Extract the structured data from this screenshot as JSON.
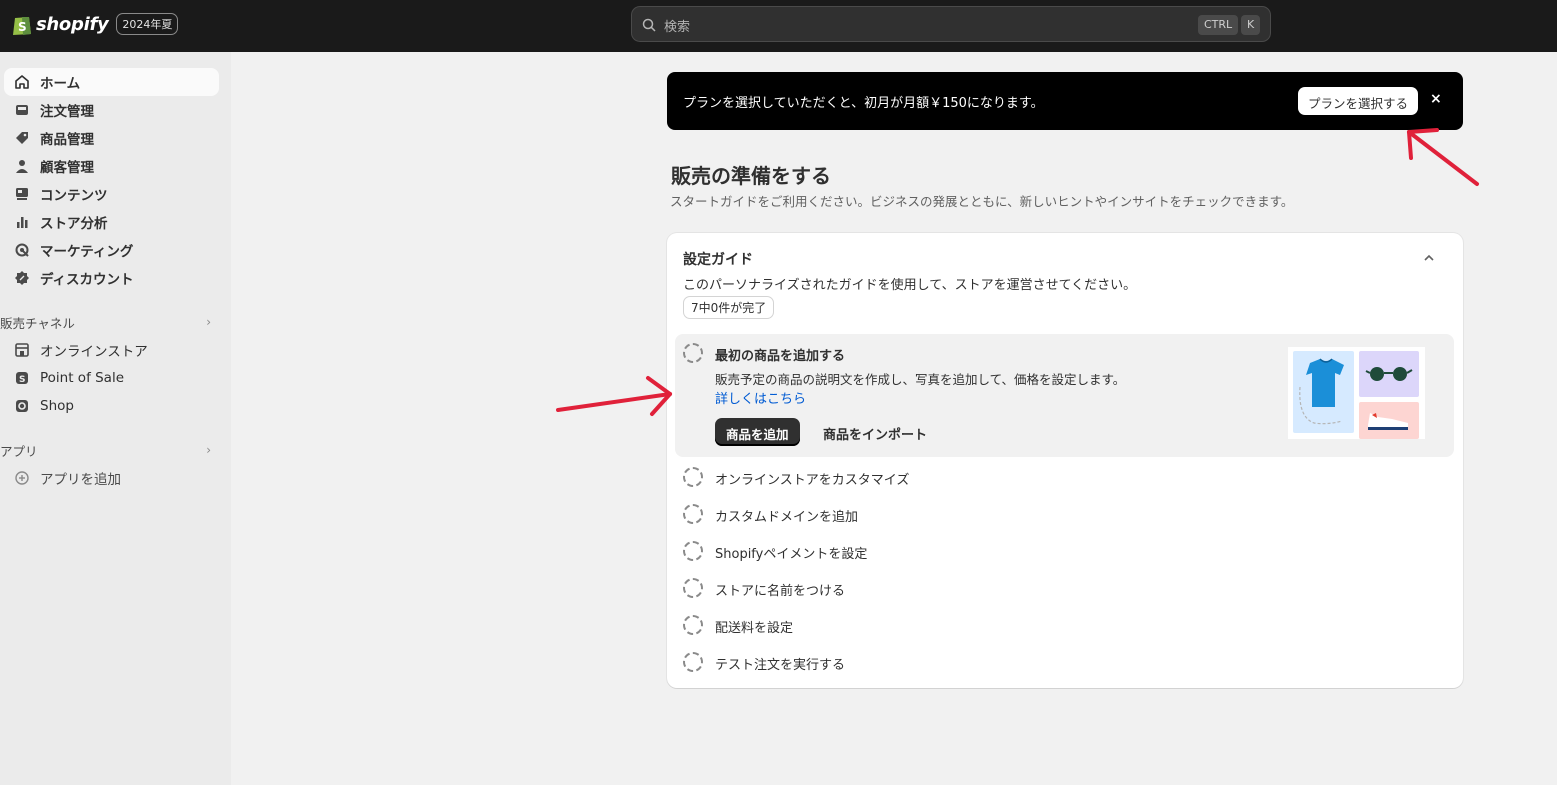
{
  "topbar": {
    "brand": "shopify",
    "edition": "2024年夏",
    "search_placeholder": "検索",
    "shortcut_ctrl": "CTRL",
    "shortcut_k": "K"
  },
  "sidebar": {
    "items": [
      {
        "label": "ホーム",
        "icon": "home-icon",
        "active": true
      },
      {
        "label": "注文管理",
        "icon": "inbox-icon"
      },
      {
        "label": "商品管理",
        "icon": "tag-icon"
      },
      {
        "label": "顧客管理",
        "icon": "person-icon"
      },
      {
        "label": "コンテンツ",
        "icon": "content-icon"
      },
      {
        "label": "ストア分析",
        "icon": "chart-icon"
      },
      {
        "label": "マーケティング",
        "icon": "target-icon"
      },
      {
        "label": "ディスカウント",
        "icon": "discount-icon"
      }
    ],
    "sales_channels_heading": "販売チャネル",
    "channels": [
      {
        "label": "オンラインストア",
        "icon": "store-icon"
      },
      {
        "label": "Point of Sale",
        "icon": "pos-icon"
      },
      {
        "label": "Shop",
        "icon": "shop-icon"
      }
    ],
    "apps_heading": "アプリ",
    "add_app": "アプリを追加"
  },
  "banner": {
    "text": "プランを選択していただくと、初月が月額￥150になります。",
    "button": "プランを選択する",
    "close": "×"
  },
  "main": {
    "title": "販売の準備をする",
    "subtitle": "スタートガイドをご利用ください。ビジネスの発展とともに、新しいヒントやインサイトをチェックできます。"
  },
  "guide": {
    "title": "設定ガイド",
    "description": "このパーソナライズされたガイドを使用して、ストアを運営させてください。",
    "progress": "7中0件が完了",
    "active_task": {
      "title": "最初の商品を追加する",
      "description": "販売予定の商品の説明文を作成し、写真を追加して、価格を設定します。",
      "link": "詳しくはこちら",
      "primary_button": "商品を追加",
      "secondary_button": "商品をインポート"
    },
    "tasks": [
      "オンラインストアをカスタマイズ",
      "カスタムドメインを追加",
      "Shopifyペイメントを設定",
      "ストアに名前をつける",
      "配送料を設定",
      "テスト注文を実行する"
    ]
  },
  "colors": {
    "topbar": "#1a1a1a",
    "annotation_arrow": "#e0213a",
    "link": "#005bd3"
  }
}
